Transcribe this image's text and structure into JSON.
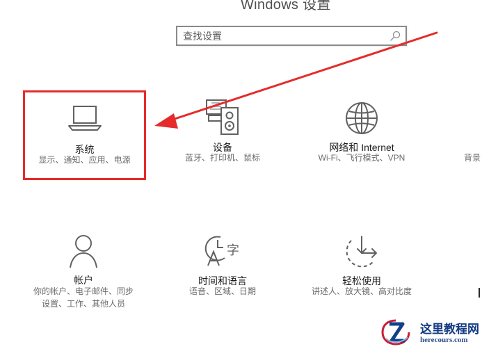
{
  "header": {
    "title": "Windows 设置"
  },
  "search": {
    "placeholder": "查找设置",
    "icon": "search-icon"
  },
  "tiles": [
    {
      "id": "system",
      "title": "系统",
      "description": "显示、通知、应用、电源",
      "icon": "laptop-icon",
      "highlighted": true,
      "highlight_color": "#e52b2b"
    },
    {
      "id": "devices",
      "title": "设备",
      "description": "蓝牙、打印机、鼠标",
      "icon": "devices-icon"
    },
    {
      "id": "network",
      "title": "网络和 Internet",
      "description": "Wi-Fi、飞行模式、VPN",
      "icon": "globe-icon"
    },
    {
      "id": "personalization",
      "description": "背景"
    },
    {
      "id": "accounts",
      "title": "帐户",
      "description_lines": [
        "你的帐户、电子邮件、同步",
        "设置、工作、其他人员"
      ],
      "icon": "person-icon"
    },
    {
      "id": "time-language",
      "title": "时间和语言",
      "description": "语音、区域、日期",
      "icon": "time-language-icon"
    },
    {
      "id": "ease-of-access",
      "title": "轻松使用",
      "description": "讲述人、放大镜、高对比度",
      "icon": "ease-of-access-icon"
    }
  ],
  "annotation": {
    "arrow_color": "#e52b2b"
  },
  "watermark": {
    "title": "这里教程网",
    "url": "herecours.com"
  },
  "colors": {
    "background": "#ffffff",
    "text_primary": "#1c1c1c",
    "text_secondary": "#6a6a6a",
    "icon_stroke": "#5f5f5f",
    "watermark_blue": "#143b82"
  }
}
